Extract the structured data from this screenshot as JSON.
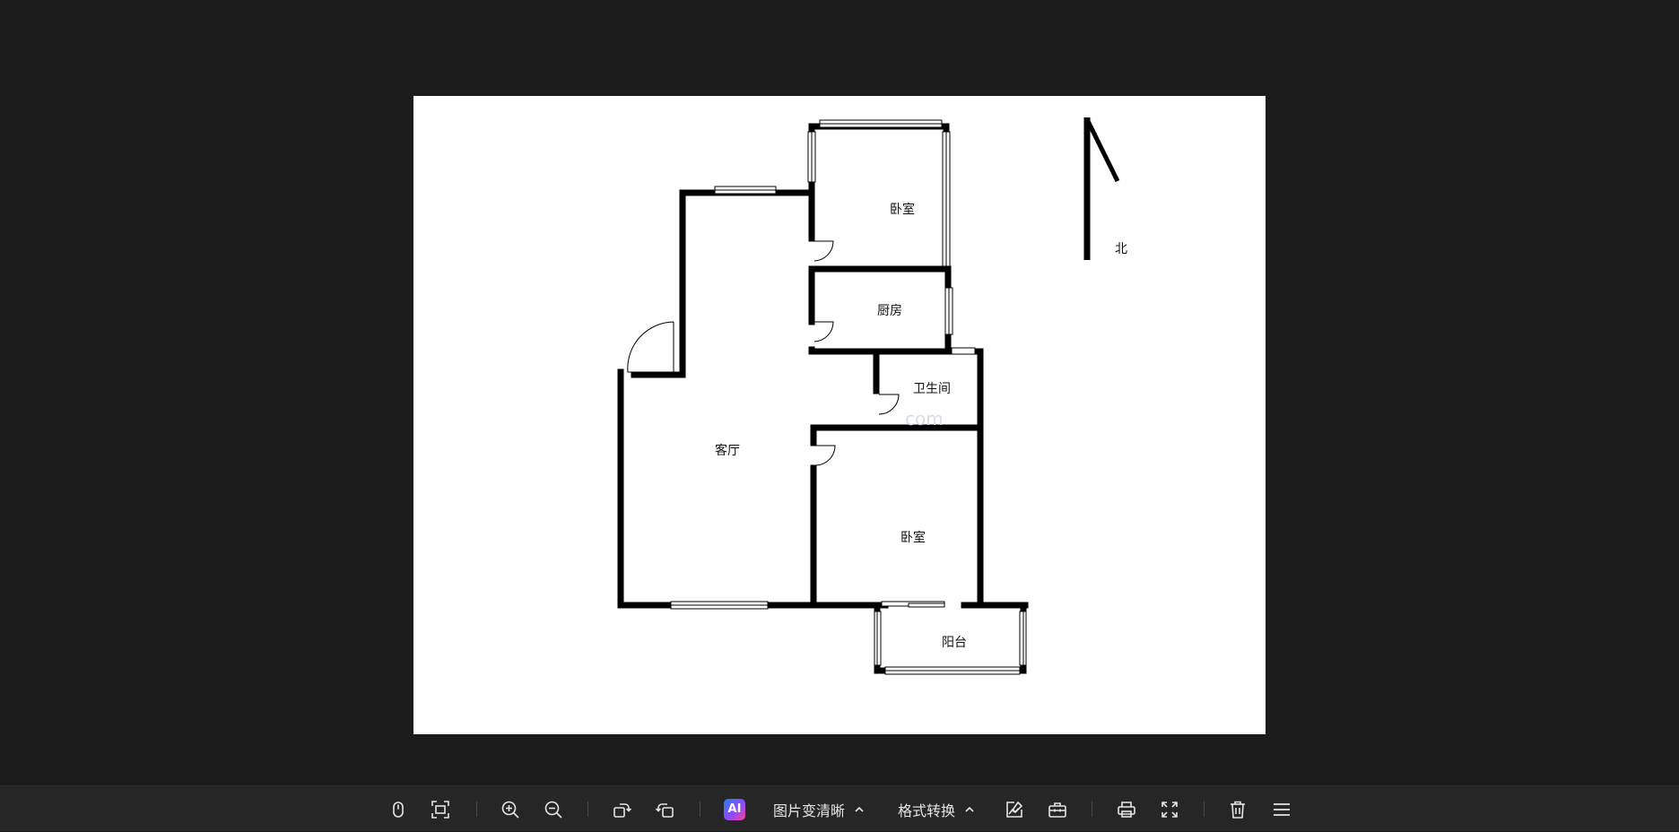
{
  "floorplan": {
    "rooms": {
      "bedroom_north": "卧室",
      "kitchen": "厨房",
      "bathroom": "卫生间",
      "living_room": "客厅",
      "bedroom_south": "卧室",
      "balcony": "阳台"
    },
    "compass_label": "北",
    "watermark": "com"
  },
  "toolbar": {
    "items": [
      {
        "id": "mouse",
        "icon": "mouse-icon"
      },
      {
        "id": "fit",
        "icon": "fit-screen-icon"
      },
      {
        "id": "zoom_in",
        "icon": "zoom-in-icon"
      },
      {
        "id": "zoom_out",
        "icon": "zoom-out-icon"
      },
      {
        "id": "rotate_right",
        "icon": "rotate-right-icon"
      },
      {
        "id": "rotate_left",
        "icon": "rotate-left-icon"
      },
      {
        "id": "ai",
        "icon": "ai-icon",
        "label": "AI"
      },
      {
        "id": "enhance",
        "label": "图片变清晰",
        "icon": "chevron-up-icon"
      },
      {
        "id": "convert",
        "label": "格式转换",
        "icon": "chevron-up-icon"
      },
      {
        "id": "edit",
        "icon": "edit-image-icon"
      },
      {
        "id": "toolbox",
        "icon": "toolbox-icon"
      },
      {
        "id": "print",
        "icon": "print-icon"
      },
      {
        "id": "fullscreen",
        "icon": "fullscreen-icon"
      },
      {
        "id": "delete",
        "icon": "trash-icon"
      },
      {
        "id": "menu",
        "icon": "menu-icon"
      }
    ]
  },
  "colors": {
    "background": "#1b1b1c",
    "toolbar": "#262627",
    "icon": "#e6e6e6",
    "wall": "#000000"
  }
}
